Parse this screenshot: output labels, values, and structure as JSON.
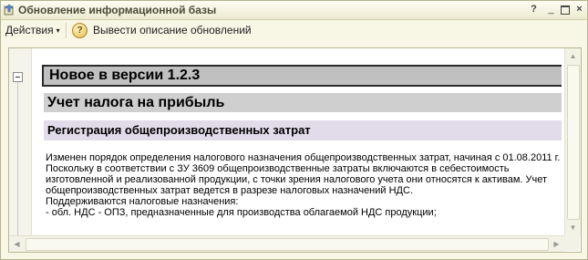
{
  "window": {
    "title": "Обновление информационной базы",
    "controls": {
      "help": "?",
      "minimize": "_",
      "close": "×"
    }
  },
  "toolbar": {
    "actions_label": "Действия",
    "actions_arrow": "▾",
    "help_glyph": "?",
    "describe_updates_label": "Вывести описание обновлений"
  },
  "content": {
    "version_heading": "Новое в версии 1.2.3",
    "section_heading": "Учет налога на прибыль",
    "subsection_heading": "Регистрация общепроизводственных затрат",
    "paragraphs": [
      "Изменен порядок определения налогового назначения общепроизводственных затрат, начиная с 01.08.2011 г.",
      "Поскольку в соответствии с ЗУ 3609 общепроизводственные затраты включаются в себестоимость изготовленной и реализованной продукции, с точки зрения налогового учета они относятся к активам. Учет общепроизводственных затрат ведется в разрезе налоговых назначений НДС.",
      "Поддерживаются налоговые назначения:",
      "- обл. НДС - ОПЗ, предназначенные для производства облагаемой НДС продукции;"
    ]
  },
  "scrollbars": {
    "up": "▲",
    "down": "▼",
    "left": "◀",
    "right": "▶"
  }
}
